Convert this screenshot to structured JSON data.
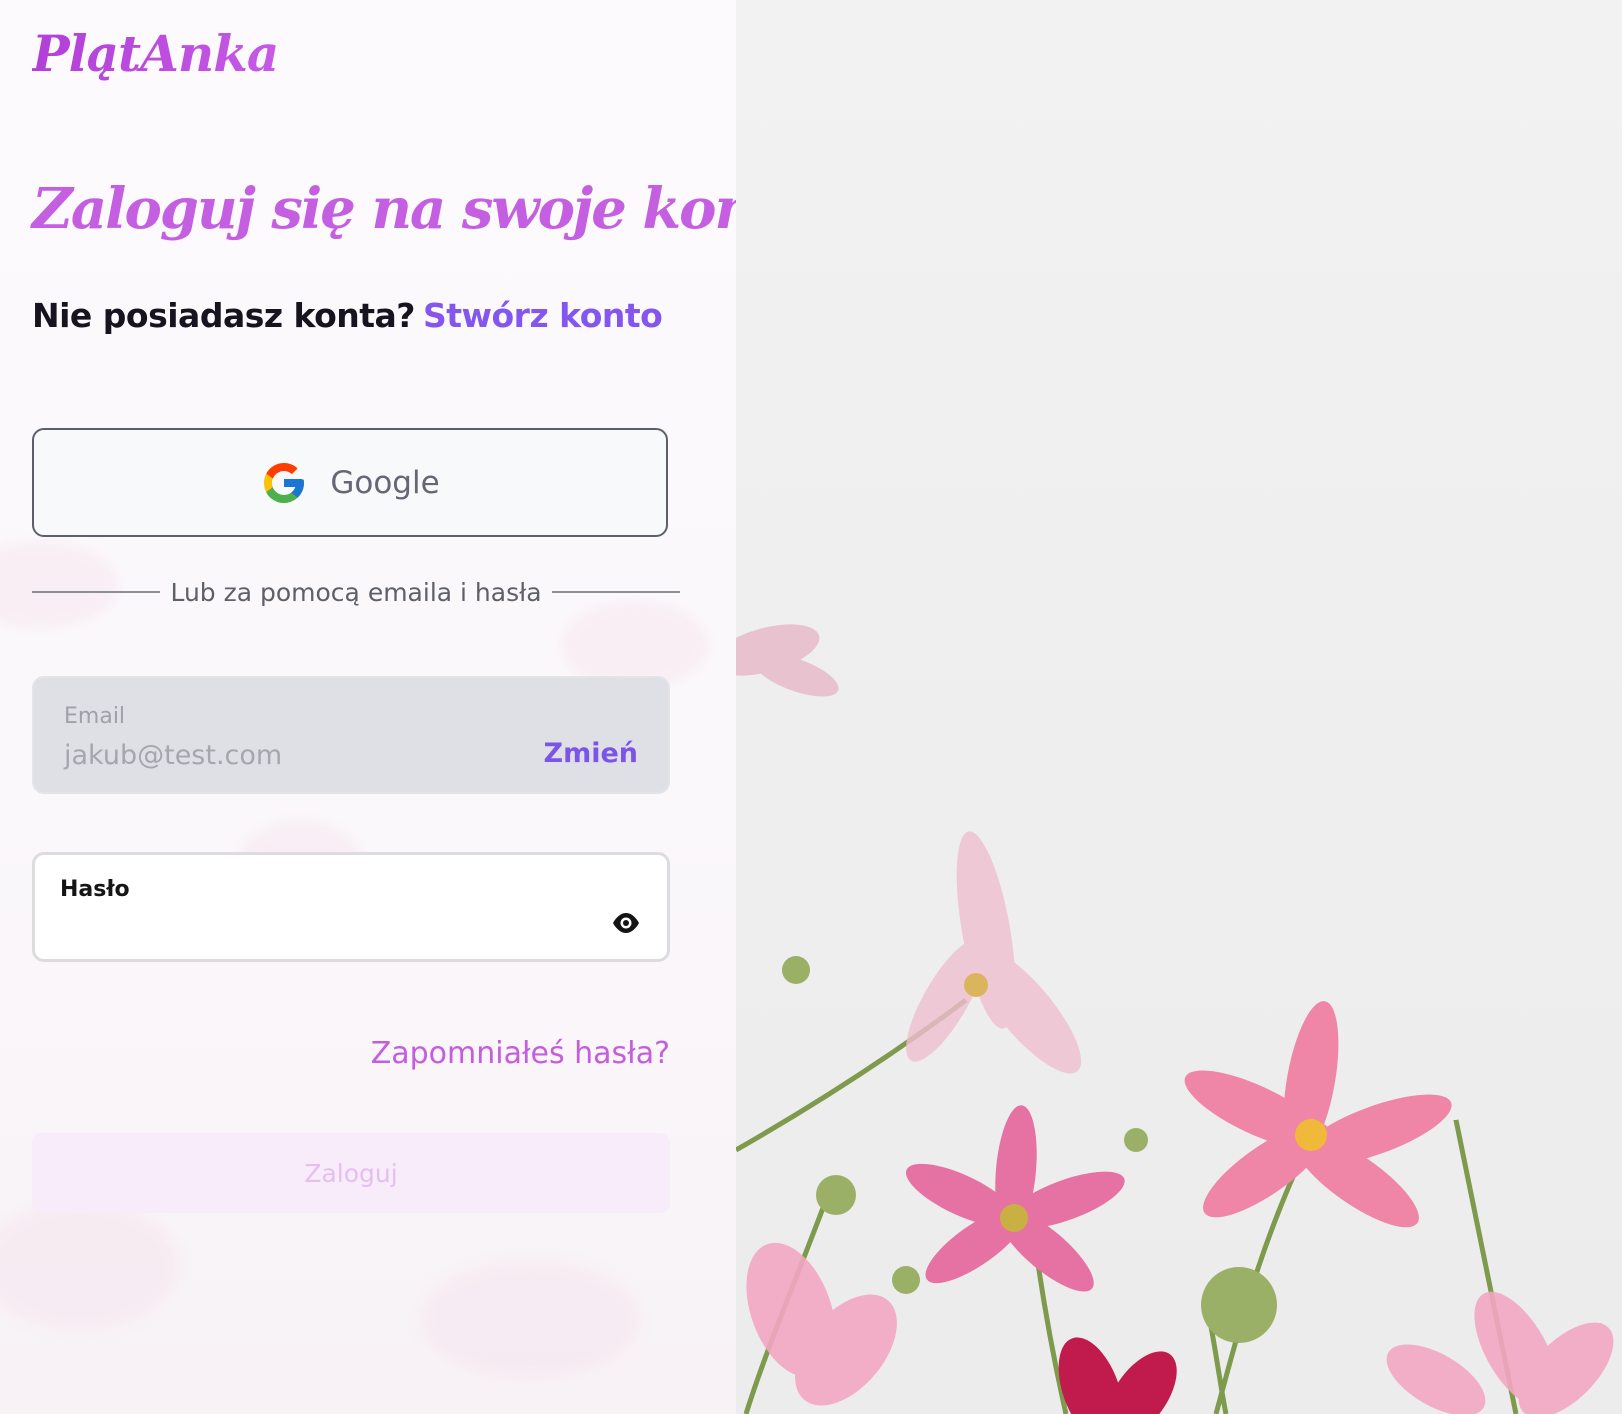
{
  "brand": {
    "logo_text": "PlątAnka"
  },
  "login": {
    "title": "Zaloguj się na swoje konto",
    "no_account_text": "Nie posiadasz konta?",
    "create_account_link": "Stwórz konto",
    "google_button_label": "Google",
    "divider_text": "Lub za pomocą emaila i hasła",
    "email": {
      "label": "Email",
      "value": "jakub@test.com",
      "change_label": "Zmień"
    },
    "password": {
      "label": "Hasło",
      "value": "",
      "toggle_icon": "eye-icon"
    },
    "forgot_password_link": "Zapomniałeś hasła?",
    "submit_label": "Zaloguj"
  },
  "colors": {
    "accent_purple": "#8256ef",
    "title_pink": "#c35fe0",
    "submit_disabled_bg": "#f8ebfa",
    "email_field_bg": "#dfe0e5"
  },
  "background_image": {
    "subject": "pink cosmos flowers against a pale sky"
  }
}
